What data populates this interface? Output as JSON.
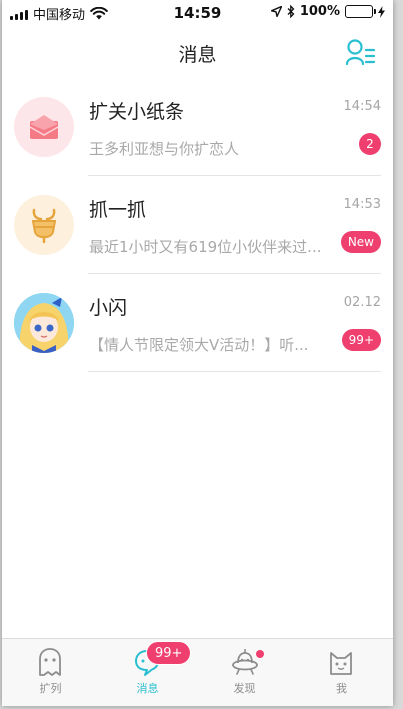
{
  "status_bar": {
    "carrier": "中国移动",
    "time": "14:59",
    "battery": "100%"
  },
  "nav": {
    "title": "消息",
    "contacts_icon": "contacts-list-icon"
  },
  "conversations": [
    {
      "title": "扩关小纸条",
      "time": "14:54",
      "preview": "王多利亚想与你扩恋人",
      "badge": "2",
      "icon": "envelope-icon"
    },
    {
      "title": "抓一抓",
      "time": "14:53",
      "preview": "最近1小时又有619位小伙伴来过...",
      "badge": "New",
      "icon": "claw-catch-icon"
    },
    {
      "title": "小闪",
      "time": "02.12",
      "preview": "【情人节限定领大V活动！】听...",
      "badge": "99+",
      "icon": "anime-girl-avatar"
    }
  ],
  "tabs": [
    {
      "label": "扩列",
      "icon": "ghost-icon"
    },
    {
      "label": "消息",
      "icon": "chat-bubble-icon",
      "badge": "99+",
      "active": true
    },
    {
      "label": "发现",
      "icon": "ufo-icon",
      "dot": true
    },
    {
      "label": "我",
      "icon": "cat-face-icon"
    }
  ],
  "colors": {
    "accent": "#29bfd1",
    "badge": "#ef3f6f",
    "battery_fill": "#3ccf3c"
  }
}
